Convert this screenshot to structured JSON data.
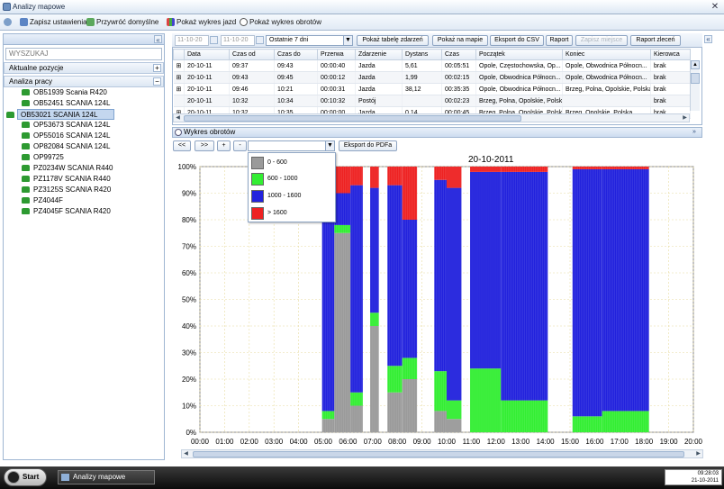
{
  "window": {
    "title": "Analizy mapowe"
  },
  "toolbar": {
    "save_settings": "Zapisz ustawienia",
    "restore_defaults": "Przywróć domyślne",
    "show_trip_chart": "Pokaż wykres jazd",
    "show_rpm_chart": "Pokaż wykres obrotów"
  },
  "left": {
    "search_placeholder": "WYSZUKAJ",
    "current_positions": "Aktualne pozycje",
    "work_analysis": "Analiza pracy",
    "vehicles": [
      "OB51939 Scania R420",
      "OB52451 SCANIA 124L",
      "OB53021 SCANIA 124L",
      "OP53673 SCANIA 124L",
      "OP55016 SCANIA 124L",
      "OP82084 SCANIA 124L",
      "OP99725",
      "PZ0234W SCANIA R440",
      "PZ1178V SCANIA R440",
      "PZ3125S SCANIA R420",
      "PZ4044F",
      "PZ4045F SCANIA R420"
    ],
    "selected_index": 2
  },
  "filter": {
    "date_from": "11-10-20",
    "date_to": "11-10-20",
    "period": "Ostatnie 7 dni",
    "buttons": {
      "show_events": "Pokaż tabelę zdarzeń",
      "show_on_map": "Pokaż na mapie",
      "export_csv": "Eksport do CSV",
      "report": "Raport",
      "save_place": "Zapisz miejsce",
      "order_report": "Raport zleceń"
    }
  },
  "table": {
    "headers": [
      "",
      "Data",
      "Czas od",
      "Czas do",
      "Przerwa",
      "Zdarzenie",
      "Dystans",
      "Czas",
      "Początek",
      "Koniec",
      "Kierowca"
    ],
    "rows": [
      [
        "⊞",
        "20-10-11",
        "09:37",
        "09:43",
        "00:00:40",
        "Jazda",
        "5,61",
        "00:05:51",
        "Opole, Częstochowska, Op...",
        "Opole, Obwodnica Północn...",
        "brak"
      ],
      [
        "⊞",
        "20-10-11",
        "09:43",
        "09:45",
        "00:00:12",
        "Jazda",
        "1,99",
        "00:02:15",
        "Opole, Obwodnica Północn...",
        "Opole, Obwodnica Północn...",
        "brak"
      ],
      [
        "⊞",
        "20-10-11",
        "09:46",
        "10:21",
        "00:00:31",
        "Jazda",
        "38,12",
        "00:35:35",
        "Opole, Obwodnica Północn...",
        "Brzeg, Polna, Opolskie, Polska",
        "brak"
      ],
      [
        "",
        "20-10-11",
        "10:32",
        "10:34",
        "00:10:32",
        "Postój",
        "",
        "00:02:23",
        "Brzeg, Polna, Opolskie, Polska",
        "",
        "brak"
      ],
      [
        "⊞",
        "20-10-11",
        "10:32",
        "10:35",
        "00:00:00",
        "Jazda",
        "0,14",
        "00:00:45",
        "Brzeg, Polna, Opolskie, Polska",
        "Brzeg, Opolskie, Polska",
        "brak"
      ]
    ]
  },
  "chart_panel": {
    "title": "Wykres obrotów",
    "nav_prev": "<<",
    "nav_next": ">>",
    "zoom_in": "+",
    "zoom_out": "-",
    "export_pdf": "Eksport do PDFa",
    "legend": [
      {
        "label": "0 - 600",
        "color": "#9a9a9a"
      },
      {
        "label": "600 - 1000",
        "color": "#33ee33"
      },
      {
        "label": "1000 - 1600",
        "color": "#2222dd"
      },
      {
        "label": "> 1600",
        "color": "#ee2222"
      }
    ]
  },
  "chart_data": {
    "type": "area",
    "title": "20-10-2011",
    "ylabel": "",
    "xlabel": "",
    "ylim": [
      0,
      100
    ],
    "yticks": [
      "0%",
      "10%",
      "20%",
      "30%",
      "40%",
      "50%",
      "60%",
      "70%",
      "80%",
      "90%",
      "100%"
    ],
    "xticks": [
      "00:00",
      "01:00",
      "02:00",
      "03:00",
      "04:00",
      "05:00",
      "06:00",
      "07:00",
      "08:00",
      "09:00",
      "10:00",
      "11:00",
      "12:00",
      "13:00",
      "14:00",
      "15:00",
      "16:00",
      "17:00",
      "18:00",
      "19:00",
      "20:00"
    ],
    "x_unit": "hour",
    "segments": [
      {
        "start": 4.95,
        "end": 5.45,
        "grey": 5,
        "green": 3,
        "blue": 85,
        "red": 7
      },
      {
        "start": 5.45,
        "end": 6.1,
        "grey": 75,
        "green": 3,
        "blue": 12,
        "red": 10
      },
      {
        "start": 6.1,
        "end": 6.6,
        "grey": 10,
        "green": 5,
        "blue": 78,
        "red": 7
      },
      {
        "start": 6.9,
        "end": 7.25,
        "grey": 40,
        "green": 5,
        "blue": 47,
        "red": 8
      },
      {
        "start": 7.6,
        "end": 8.2,
        "grey": 15,
        "green": 10,
        "blue": 68,
        "red": 7
      },
      {
        "start": 8.2,
        "end": 8.8,
        "grey": 20,
        "green": 8,
        "blue": 52,
        "red": 20
      },
      {
        "start": 9.5,
        "end": 10.0,
        "grey": 8,
        "green": 15,
        "blue": 72,
        "red": 5
      },
      {
        "start": 10.0,
        "end": 10.6,
        "grey": 5,
        "green": 7,
        "blue": 80,
        "red": 8
      },
      {
        "start": 10.95,
        "end": 12.2,
        "grey": 0,
        "green": 24,
        "blue": 74,
        "red": 2
      },
      {
        "start": 12.2,
        "end": 14.1,
        "grey": 0,
        "green": 12,
        "blue": 86,
        "red": 2
      },
      {
        "start": 15.1,
        "end": 16.3,
        "grey": 0,
        "green": 6,
        "blue": 93,
        "red": 1
      },
      {
        "start": 16.3,
        "end": 18.2,
        "grey": 0,
        "green": 8,
        "blue": 91,
        "red": 1
      }
    ]
  },
  "taskbar": {
    "start": "Start",
    "active_window": "Analizy mapowe",
    "time": "09:28:03",
    "date": "21-10-2011"
  }
}
